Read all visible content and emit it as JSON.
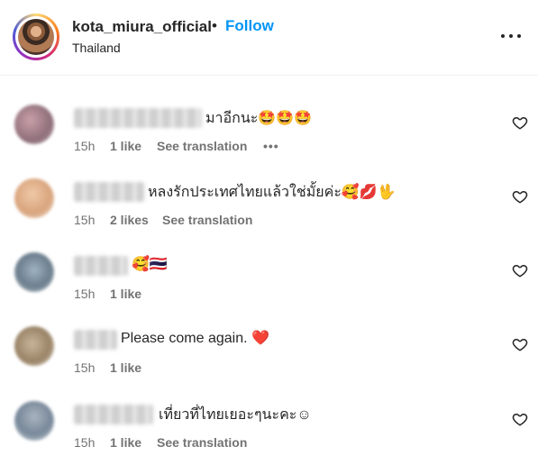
{
  "header": {
    "username": "kota_miura_official",
    "separator": "•",
    "follow_label": "Follow",
    "location": "Thailand"
  },
  "comments": [
    {
      "text": "มาอีกนะ🤩🤩🤩",
      "time": "15h",
      "likes": "1 like",
      "translation": "See translation",
      "more": "•••"
    },
    {
      "text": "หลงรักประเทศไทยแล้วใช่มั้ยค่ะ🥰💋🖖",
      "time": "15h",
      "likes": "2 likes",
      "translation": "See translation"
    },
    {
      "text": "🥰🇹🇭",
      "time": "15h",
      "likes": "1 like"
    },
    {
      "text": "Please come again. ❤️",
      "time": "15h",
      "likes": "1 like"
    },
    {
      "text": "เที่ยวที่ไทยเยอะๆนะคะ☺",
      "time": "15h",
      "likes": "1 like",
      "translation": "See translation"
    }
  ],
  "icons": {
    "more": "more-horizontal-icon",
    "like": "heart-outline-icon"
  },
  "colors": {
    "follow": "#0095f6",
    "meta": "#737373",
    "text": "#262626"
  }
}
